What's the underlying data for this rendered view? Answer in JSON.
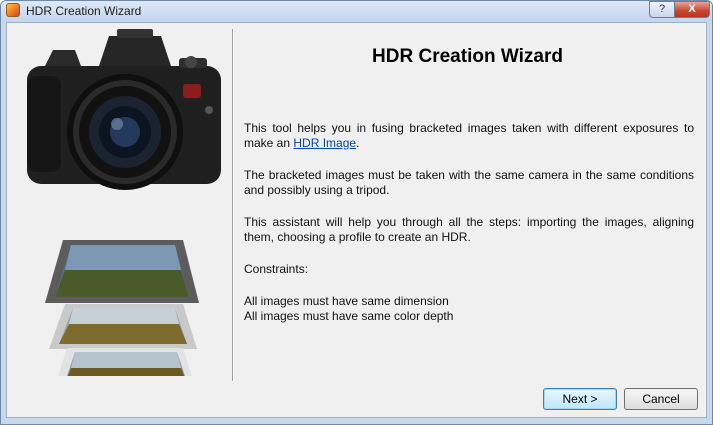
{
  "window": {
    "title": "HDR Creation Wizard",
    "help_glyph": "?",
    "close_glyph": "X",
    "title_icon": "hdr-app-icon"
  },
  "content": {
    "heading": "HDR Creation Wizard",
    "intro_before_link": "This tool helps you in fusing bracketed images taken with different exposures to make an ",
    "intro_link": "HDR Image",
    "intro_after_link": ".",
    "paragraph_2": "The bracketed images must be taken with the same camera in the same conditions and possibly using a tripod.",
    "paragraph_3": "This assistant will help you through all the steps: importing the images, aligning them, choosing a profile to create an HDR.",
    "constraints_title": "Constraints:",
    "constraints": [
      "All images must have same dimension",
      "All images must have same color depth"
    ]
  },
  "buttons": {
    "next": "Next >",
    "cancel": "Cancel"
  },
  "colors": {
    "link": "#0645ad",
    "close_button": "#c7452d",
    "titlebar": "#c3d6ee"
  }
}
